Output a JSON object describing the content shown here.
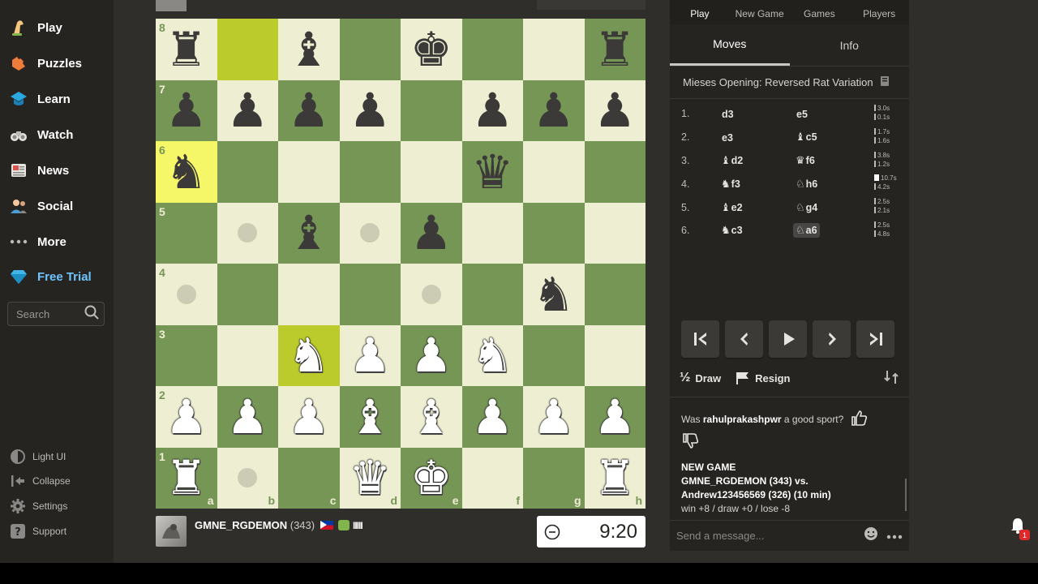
{
  "sidebar": {
    "items": [
      {
        "label": "Play",
        "icon": "play-hand-icon"
      },
      {
        "label": "Puzzles",
        "icon": "puzzle-icon"
      },
      {
        "label": "Learn",
        "icon": "learn-cap-icon"
      },
      {
        "label": "Watch",
        "icon": "binoculars-icon"
      },
      {
        "label": "News",
        "icon": "newspaper-icon"
      },
      {
        "label": "Social",
        "icon": "people-icon"
      },
      {
        "label": "More",
        "icon": "more-dots-icon"
      },
      {
        "label": "Free Trial",
        "icon": "diamond-icon"
      }
    ],
    "search_placeholder": "Search",
    "bottom": [
      {
        "label": "Light UI"
      },
      {
        "label": "Collapse"
      },
      {
        "label": "Settings"
      },
      {
        "label": "Support"
      }
    ]
  },
  "board": {
    "ranks": [
      "8",
      "7",
      "6",
      "5",
      "4",
      "3",
      "2",
      "1"
    ],
    "files": [
      "a",
      "b",
      "c",
      "d",
      "e",
      "f",
      "g",
      "h"
    ],
    "rows": [
      [
        "r",
        "",
        "b",
        "",
        "k",
        "",
        "",
        "r"
      ],
      [
        "p",
        "p",
        "p",
        "p",
        "",
        "p",
        "p",
        "p"
      ],
      [
        "n",
        "",
        "",
        "",
        "",
        "q",
        "",
        ""
      ],
      [
        "",
        ".",
        "b",
        ".",
        "p",
        "",
        "",
        ""
      ],
      [
        ".",
        "",
        "",
        "",
        ".",
        "",
        "n",
        ""
      ],
      [
        "",
        "",
        "N",
        "P",
        "P",
        "N",
        "",
        ""
      ],
      [
        "P",
        "P",
        "P",
        "B",
        "B",
        "P",
        "P",
        "P"
      ],
      [
        "R",
        ".",
        "",
        "Q",
        "K",
        "",
        "",
        "R"
      ]
    ],
    "highlights": [
      "b8",
      "a6",
      "c3"
    ]
  },
  "player": {
    "name": "GMNE_RGDEMON",
    "rating": "(343)",
    "signal": "IIIII"
  },
  "clock": {
    "time": "9:20"
  },
  "panel": {
    "top_tabs": [
      "Play",
      "New Game",
      "Games",
      "Players"
    ],
    "sub_tabs": [
      "Moves",
      "Info"
    ],
    "opening": "Mieses Opening: Reversed Rat Variation",
    "moves": [
      {
        "num": "1.",
        "w_piece": "",
        "w_sq": "d3",
        "b_piece": "",
        "b_sq": "e5",
        "t1": "3.0s",
        "t2": "0.1s"
      },
      {
        "num": "2.",
        "w_piece": "",
        "w_sq": "e3",
        "b_piece": "♝",
        "b_sq": "c5",
        "t1": "1.7s",
        "t2": "1.6s"
      },
      {
        "num": "3.",
        "w_piece": "♝",
        "w_sq": "d2",
        "b_piece": "♛",
        "b_sq": "f6",
        "t1": "3.8s",
        "t2": "1.2s"
      },
      {
        "num": "4.",
        "w_piece": "♞",
        "w_sq": "f3",
        "b_piece": "♘",
        "b_sq": "h6",
        "t1": "10.7s",
        "t2": "4.2s"
      },
      {
        "num": "5.",
        "w_piece": "♝",
        "w_sq": "e2",
        "b_piece": "♘",
        "b_sq": "g4",
        "t1": "2.5s",
        "t2": "2.1s"
      },
      {
        "num": "6.",
        "w_piece": "♞",
        "w_sq": "c3",
        "b_piece": "♘",
        "b_sq": "a6",
        "t1": "2.5s",
        "t2": "4.8s"
      }
    ],
    "draw_label": "Draw",
    "resign_label": "Resign",
    "half_symbol": "½",
    "chat": {
      "sport_prefix": "Was ",
      "sport_name": "rahulprakashpwr",
      "sport_suffix": " a good sport?",
      "new_game": "NEW GAME",
      "line1": "GMNE_RGDEMON (343) vs.",
      "line2": "Andrew123456569 (326) (10 min)",
      "line3": "win +8 / draw +0 / lose -8"
    },
    "message_placeholder": "Send a message..."
  },
  "notifications": {
    "count": "1"
  }
}
